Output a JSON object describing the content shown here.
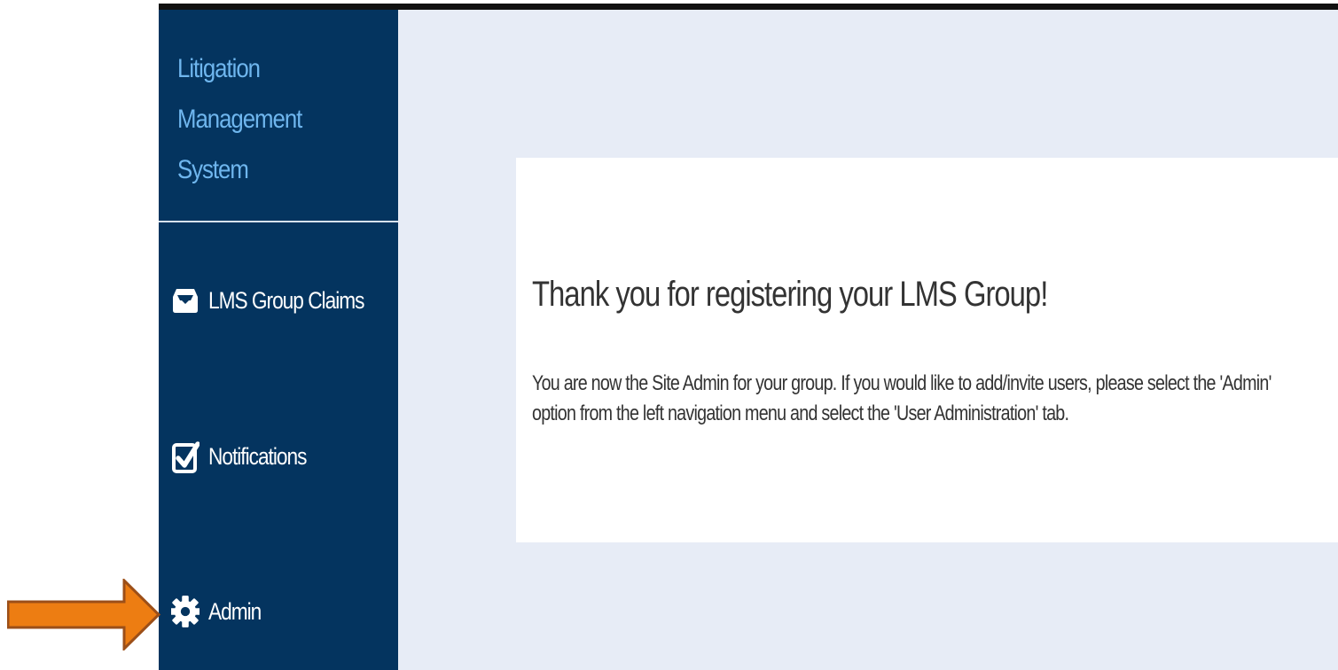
{
  "app": {
    "title_lines": [
      "Litigation",
      "Management",
      "System"
    ]
  },
  "sidebar": {
    "items": [
      {
        "label": "LMS Group Claims",
        "icon": "inbox-icon"
      },
      {
        "label": "Notifications",
        "icon": "checkbox-icon"
      },
      {
        "label": "Admin",
        "icon": "gear-icon"
      }
    ]
  },
  "message": {
    "title": "Thank you for registering your LMS Group!",
    "body": "You are now the Site Admin for your group. If you would like to add/invite users, please select the 'Admin' option from the left navigation menu and select the 'User Administration' tab."
  },
  "colors": {
    "sidebar": "#04345f",
    "brand": "#6fb6ee",
    "content_background": "#e7ecf6",
    "card": "#ffffff",
    "arrow": "#ed7d12",
    "arrow_outline": "#9c4f18"
  },
  "annotation": {
    "callout": "arrow-icon"
  }
}
